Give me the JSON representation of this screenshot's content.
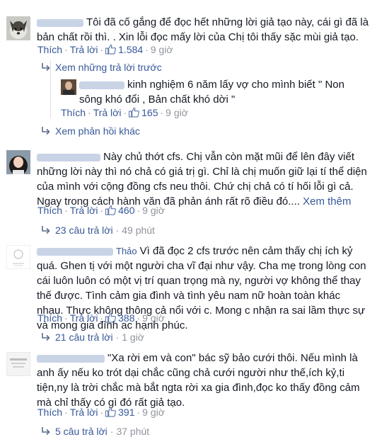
{
  "action_labels": {
    "like": "Thích",
    "reply": "Trả lời",
    "sep": "·"
  },
  "comments": [
    {
      "text": "Tôi đã cố gắng để đọc hết những lời giả tạo này, cái gì đã là bản chất rồi thì. . Xin lỗi đọc mấy lời của Chị tôi thấy sặc mùi giả tạo.",
      "likes": "1.584",
      "time": "9 giờ",
      "previous_replies": "Xem những trả lời trước",
      "reply": {
        "text": "kinh nghiệm 6 năm lấy vợ cho mình biết \" Non sông khó đổi , Bản chất khó dời \"",
        "likes": "165",
        "time": "9 giờ"
      },
      "more_replies": "Xem phản hồi khác"
    },
    {
      "text": "Này chủ thớt cfs. Chị vẫn còn mặt mũi để lên đây viết những lời này thì nó chả có giá trị gì. Chỉ là chị muốn giữ lại tí thể diện của mình với cộng đồng cfs neu thôi. Chứ chị chả có tí hối lỗi gì cả. Ngay trong cách hành văn đã phản ánh rất rõ điều đó....",
      "see_more": "Xem thêm",
      "likes": "460",
      "time": "9 giờ",
      "replies_count": "23 câu trả lời",
      "replies_time": "49 phút"
    },
    {
      "name_tail": "Thảo",
      "text": "Vì đã đọc 2 cfs trước nên cảm thấy chị ích kỷ quá. Ghen tị với một người cha vĩ đại như vậy. Cha mẹ trong lòng con cái luôn luôn có một vị trí quan trọng mà ny, người vợ không thể thay thế được. Tình cảm gia đình và tình yêu nam nữ hoàn toàn khác nhau. Thực không thông cả nổi với c. Mong c nhận ra sai lầm thực sự và mong gia đình ac hạnh phúc.",
      "likes": "388",
      "time": "9 giờ",
      "replies_count": "21 câu trả lời",
      "replies_time": "1 giờ"
    },
    {
      "text": "\"Xa rời em và con\" bác sỹ bảo cưới thôi. Nếu mình là anh ấy nếu ko trót dại chắc cũng chả cưới người như thế,ích kỷ,ti tiện,ny là trời chắc mà bắt ngta rời xa gia đình,đọc ko thấy đồng cảm mà chỉ thấy có gì đó rất giả tạo.",
      "likes": "391",
      "time": "9 giờ",
      "replies_count": "5 câu trả lời",
      "replies_time": "37 phút"
    }
  ],
  "colors": {
    "link": "#365899",
    "meta": "#90949c",
    "text": "#141823"
  }
}
